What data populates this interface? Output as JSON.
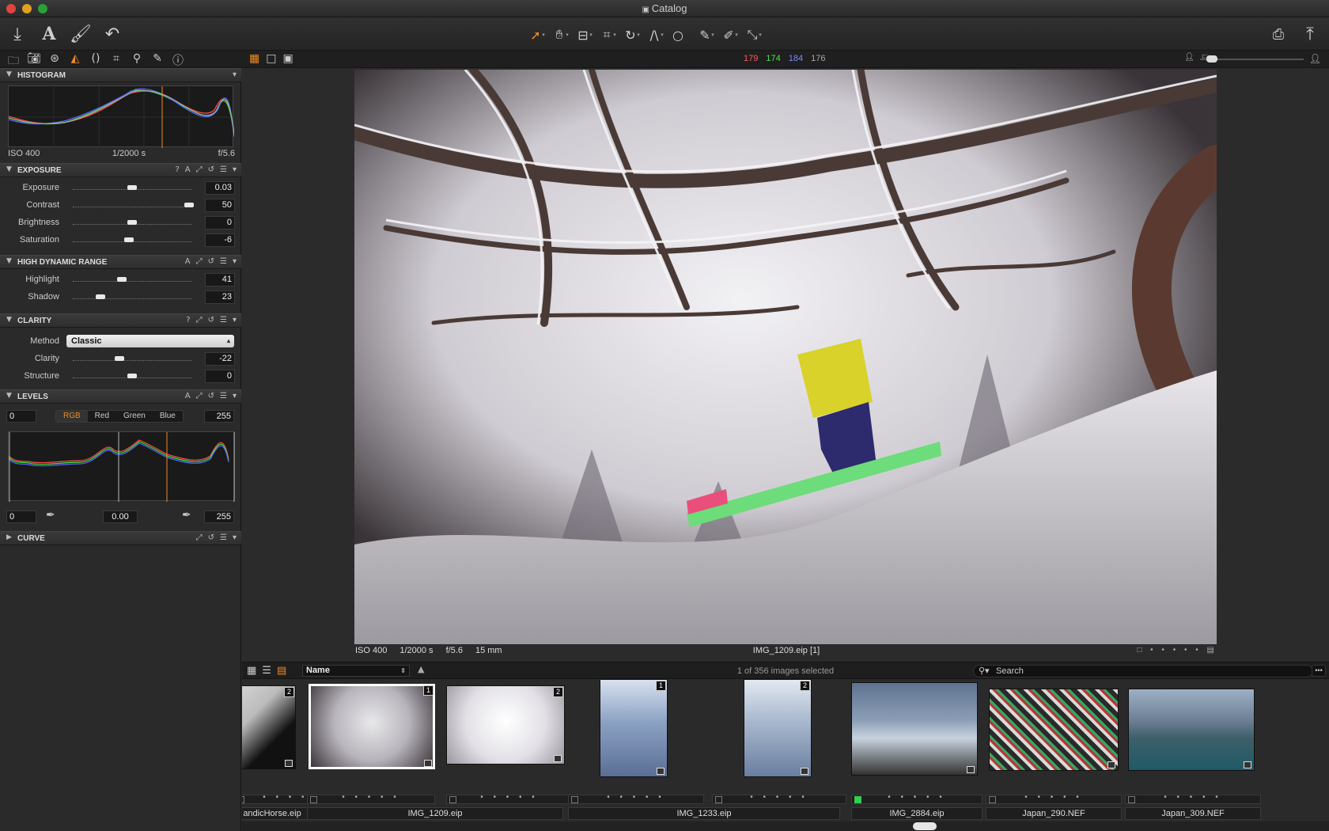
{
  "window": {
    "title": "Catalog"
  },
  "toolbar": {
    "import_icon": "import-icon",
    "text_icon": "A",
    "brush_icon": "brush-icon",
    "undo_icon": "undo-icon",
    "print_icon": "print-icon",
    "export_icon": "export-icon"
  },
  "readout": {
    "r": "179",
    "g": "174",
    "b": "184",
    "l": "176",
    "r_color": "#ff5a5a",
    "g_color": "#55e055",
    "b_color": "#7b8bff",
    "l_color": "#aaaaaa"
  },
  "zoom": {
    "fit_label": "Fit",
    "level": 0.05
  },
  "histogram": {
    "title": "HISTOGRAM",
    "iso": "ISO 400",
    "shutter": "1/2000 s",
    "aperture": "f/5.6"
  },
  "exposure": {
    "title": "EXPOSURE",
    "icons": [
      "?",
      "A"
    ],
    "rows": [
      {
        "label": "Exposure",
        "value": "0.03",
        "pos": 0.5
      },
      {
        "label": "Contrast",
        "value": "50",
        "pos": 0.98
      },
      {
        "label": "Brightness",
        "value": "0",
        "pos": 0.5
      },
      {
        "label": "Saturation",
        "value": "-6",
        "pos": 0.47
      }
    ]
  },
  "hdr": {
    "title": "HIGH DYNAMIC RANGE",
    "icons": [
      "A"
    ],
    "rows": [
      {
        "label": "Highlight",
        "value": "41",
        "pos": 0.41
      },
      {
        "label": "Shadow",
        "value": "23",
        "pos": 0.23
      }
    ]
  },
  "clarity": {
    "title": "CLARITY",
    "icons": [
      "?"
    ],
    "method_label": "Method",
    "method_value": "Classic",
    "rows": [
      {
        "label": "Clarity",
        "value": "-22",
        "pos": 0.39
      },
      {
        "label": "Structure",
        "value": "0",
        "pos": 0.5
      }
    ]
  },
  "levels": {
    "title": "LEVELS",
    "icons": [
      "A"
    ],
    "input_low": "0",
    "input_high": "255",
    "channels": [
      "RGB",
      "Red",
      "Green",
      "Blue"
    ],
    "active_channel": "RGB",
    "output_low": "0",
    "gamma": "0.00",
    "output_high": "255"
  },
  "curve": {
    "title": "CURVE"
  },
  "viewer": {
    "iso": "ISO 400",
    "shutter": "1/2000 s",
    "aperture": "f/5.6",
    "focal": "15 mm",
    "filename": "IMG_1209.eip [1]"
  },
  "browser": {
    "sort_value": "Name",
    "selection": "1 of 356 images selected",
    "search_placeholder": "Search"
  },
  "thumbnails": [
    {
      "name": "andicHorse.eip",
      "badge": "2",
      "kind": "horse"
    },
    {
      "name": "IMG_1209.eip",
      "badge": "1",
      "kind": "ski-color",
      "selected": true
    },
    {
      "name": "",
      "badge": "2",
      "kind": "ski-bright"
    },
    {
      "name": "IMG_1233.eip",
      "badge": "1",
      "kind": "ski-vert"
    },
    {
      "name": "",
      "badge": "2",
      "kind": "ski-vert2"
    },
    {
      "name": "IMG_2884.eip",
      "badge": "",
      "kind": "coast",
      "color_tag": "#2fcf4f"
    },
    {
      "name": "Japan_290.NEF",
      "badge": "",
      "kind": "cars"
    },
    {
      "name": "Japan_309.NEF",
      "badge": "",
      "kind": "bay"
    }
  ]
}
